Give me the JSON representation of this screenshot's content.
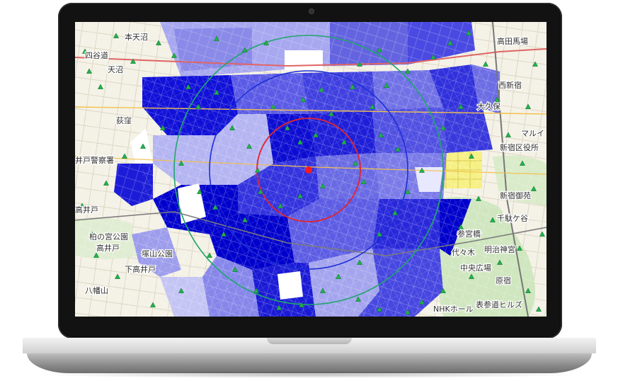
{
  "map": {
    "place_labels": [
      "本天沼",
      "天沼",
      "荻窪",
      "井戸警察署",
      "高井戸",
      "柏の宮公園",
      "高井戸",
      "塚山公園",
      "下高井戸",
      "高田馬場",
      "大久保",
      "新宿区役所",
      "マルイ",
      "新宿御苑",
      "千駄ケ谷",
      "参宮橋",
      "代々木",
      "明治神宮",
      "中央広場",
      "原宿",
      "表参道ヒルズ",
      "NHKホール",
      "四谷道",
      "西新宿",
      "八幡山"
    ],
    "colors": {
      "center_marker": "#ff1a1a",
      "inner_ring": "#e0242e",
      "middle_ring": "#1c2fd6",
      "outer_ring": "#1fa56b",
      "station_marker": "#22b14c",
      "zone_dark": "#1010d8",
      "zone_mid": "#5a5ae6",
      "zone_light": "#a8a8f0",
      "zone_pale": "#d2d2f7"
    },
    "icons": [
      "station-marker-icon",
      "center-point-icon"
    ]
  }
}
